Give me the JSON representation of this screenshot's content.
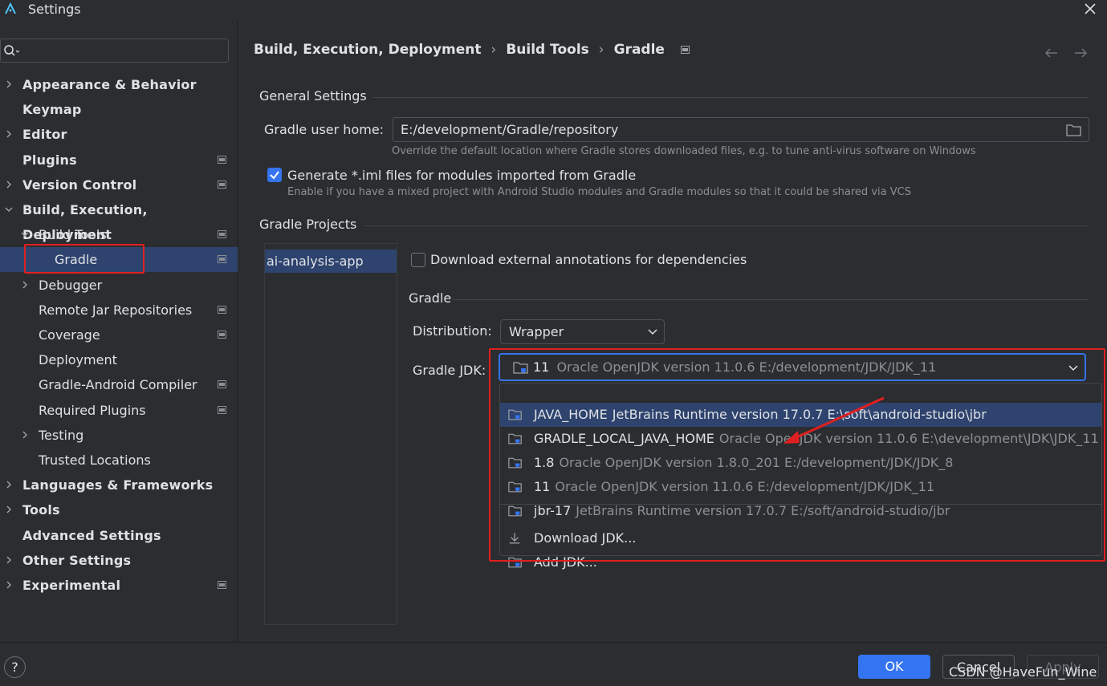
{
  "window": {
    "title": "Settings"
  },
  "sidebar": {
    "search": {
      "value": "",
      "placeholder": ""
    },
    "items": [
      {
        "label": "Appearance & Behavior",
        "level": 0,
        "expandable": true,
        "expanded": false,
        "project_icon": false
      },
      {
        "label": "Keymap",
        "level": 0,
        "expandable": false,
        "project_icon": false
      },
      {
        "label": "Editor",
        "level": 0,
        "expandable": true,
        "expanded": false,
        "project_icon": false
      },
      {
        "label": "Plugins",
        "level": 0,
        "expandable": false,
        "project_icon": true
      },
      {
        "label": "Version Control",
        "level": 0,
        "expandable": true,
        "expanded": false,
        "project_icon": true
      },
      {
        "label": "Build, Execution, Deployment",
        "level": 0,
        "expandable": true,
        "expanded": true,
        "project_icon": false
      },
      {
        "label": "Build Tools",
        "level": 1,
        "expandable": true,
        "expanded": true,
        "project_icon": true
      },
      {
        "label": "Gradle",
        "level": 2,
        "expandable": false,
        "project_icon": true,
        "selected": true
      },
      {
        "label": "Debugger",
        "level": 1,
        "expandable": true,
        "expanded": false,
        "project_icon": false
      },
      {
        "label": "Remote Jar Repositories",
        "level": 1,
        "expandable": false,
        "project_icon": true
      },
      {
        "label": "Coverage",
        "level": 1,
        "expandable": false,
        "project_icon": true
      },
      {
        "label": "Deployment",
        "level": 1,
        "expandable": false,
        "project_icon": false
      },
      {
        "label": "Gradle-Android Compiler",
        "level": 1,
        "expandable": false,
        "project_icon": true
      },
      {
        "label": "Required Plugins",
        "level": 1,
        "expandable": false,
        "project_icon": true
      },
      {
        "label": "Testing",
        "level": 1,
        "expandable": true,
        "expanded": false,
        "project_icon": false
      },
      {
        "label": "Trusted Locations",
        "level": 1,
        "expandable": false,
        "project_icon": false
      },
      {
        "label": "Languages & Frameworks",
        "level": 0,
        "expandable": true,
        "expanded": false,
        "project_icon": false
      },
      {
        "label": "Tools",
        "level": 0,
        "expandable": true,
        "expanded": false,
        "project_icon": false
      },
      {
        "label": "Advanced Settings",
        "level": 0,
        "expandable": false,
        "project_icon": false
      },
      {
        "label": "Other Settings",
        "level": 0,
        "expandable": true,
        "expanded": false,
        "project_icon": false
      },
      {
        "label": "Experimental",
        "level": 0,
        "expandable": true,
        "expanded": false,
        "project_icon": true
      }
    ]
  },
  "breadcrumb": [
    "Build, Execution, Deployment",
    "Build Tools",
    "Gradle"
  ],
  "general": {
    "section_title": "General Settings",
    "gradle_home_label": "Gradle user home:",
    "gradle_home_value": "E:/development/Gradle/repository",
    "gradle_home_hint": "Override the default location where Gradle stores downloaded files, e.g. to tune anti-virus software on Windows",
    "iml_label": "Generate *.iml files for modules imported from Gradle",
    "iml_checked": true,
    "iml_hint": "Enable if you have a mixed project with Android Studio modules and Gradle modules so that it could be shared via VCS"
  },
  "projects": {
    "section_title": "Gradle Projects",
    "list": [
      "ai-analysis-app"
    ],
    "download_annotations_label": "Download external annotations for dependencies",
    "download_annotations_checked": false,
    "gradle_section_title": "Gradle",
    "distribution_label": "Distribution:",
    "distribution_value": "Wrapper",
    "jdk_label": "Gradle JDK:",
    "jdk_value_name": "11",
    "jdk_value_desc": "Oracle OpenJDK version 11.0.6 E:/development/JDK/JDK_11"
  },
  "jdk_options": [
    {
      "name": "JAVA_HOME",
      "desc": "JetBrains Runtime version 17.0.7 E:\\soft\\android-studio\\jbr",
      "icon": "jdk-folder-icon",
      "selected": true
    },
    {
      "name": "GRADLE_LOCAL_JAVA_HOME",
      "desc": "Oracle OpenJDK version 11.0.6 E:\\development\\JDK\\JDK_11",
      "icon": "jdk-folder-icon"
    },
    {
      "name": "1.8",
      "desc": "Oracle OpenJDK version 1.8.0_201 E:/development/JDK/JDK_8",
      "icon": "jdk-folder-icon"
    },
    {
      "name": "11",
      "desc": "Oracle OpenJDK version 11.0.6 E:/development/JDK/JDK_11",
      "icon": "jdk-folder-icon"
    },
    {
      "name": "jbr-17",
      "desc": "JetBrains Runtime version 17.0.7 E:/soft/android-studio/jbr",
      "icon": "jdk-folder-icon"
    }
  ],
  "jdk_actions": [
    {
      "label": "Download JDK...",
      "icon": "download-icon"
    },
    {
      "label": "Add JDK...",
      "icon": "jdk-folder-icon"
    }
  ],
  "buttons": {
    "help": "?",
    "ok": "OK",
    "cancel": "Cancel",
    "apply": "Apply"
  },
  "watermark": "CSDN @HaveFun_Wine",
  "colors": {
    "accent": "#3574f0",
    "selection": "#2e436e",
    "annotation": "#e02020",
    "background": "#2b2d30"
  }
}
